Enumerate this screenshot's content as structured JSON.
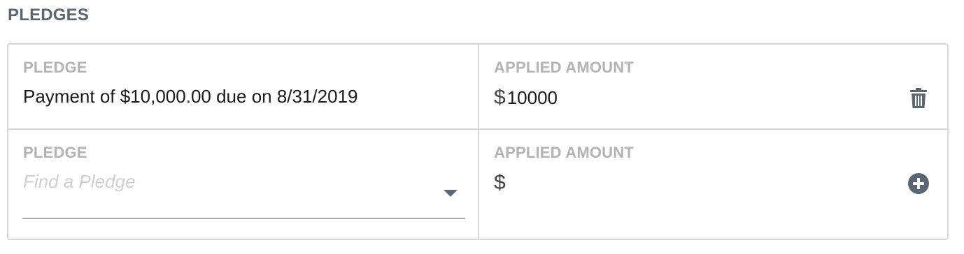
{
  "section": {
    "title": "PLEDGES"
  },
  "rows": [
    {
      "pledge_label": "PLEDGE",
      "pledge_value": "Payment of $10,000.00 due on 8/31/2019",
      "amount_label": "APPLIED AMOUNT",
      "amount_symbol": "$",
      "amount_value": "10000",
      "action_icon": "trash-icon"
    },
    {
      "pledge_label": "PLEDGE",
      "pledge_placeholder": "Find a Pledge",
      "amount_label": "APPLIED AMOUNT",
      "amount_symbol": "$",
      "amount_value": "",
      "action_icon": "plus-circle-icon"
    }
  ],
  "colors": {
    "icon": "#5b6670",
    "label": "#b3b3b3",
    "border": "#d8d8d8"
  }
}
